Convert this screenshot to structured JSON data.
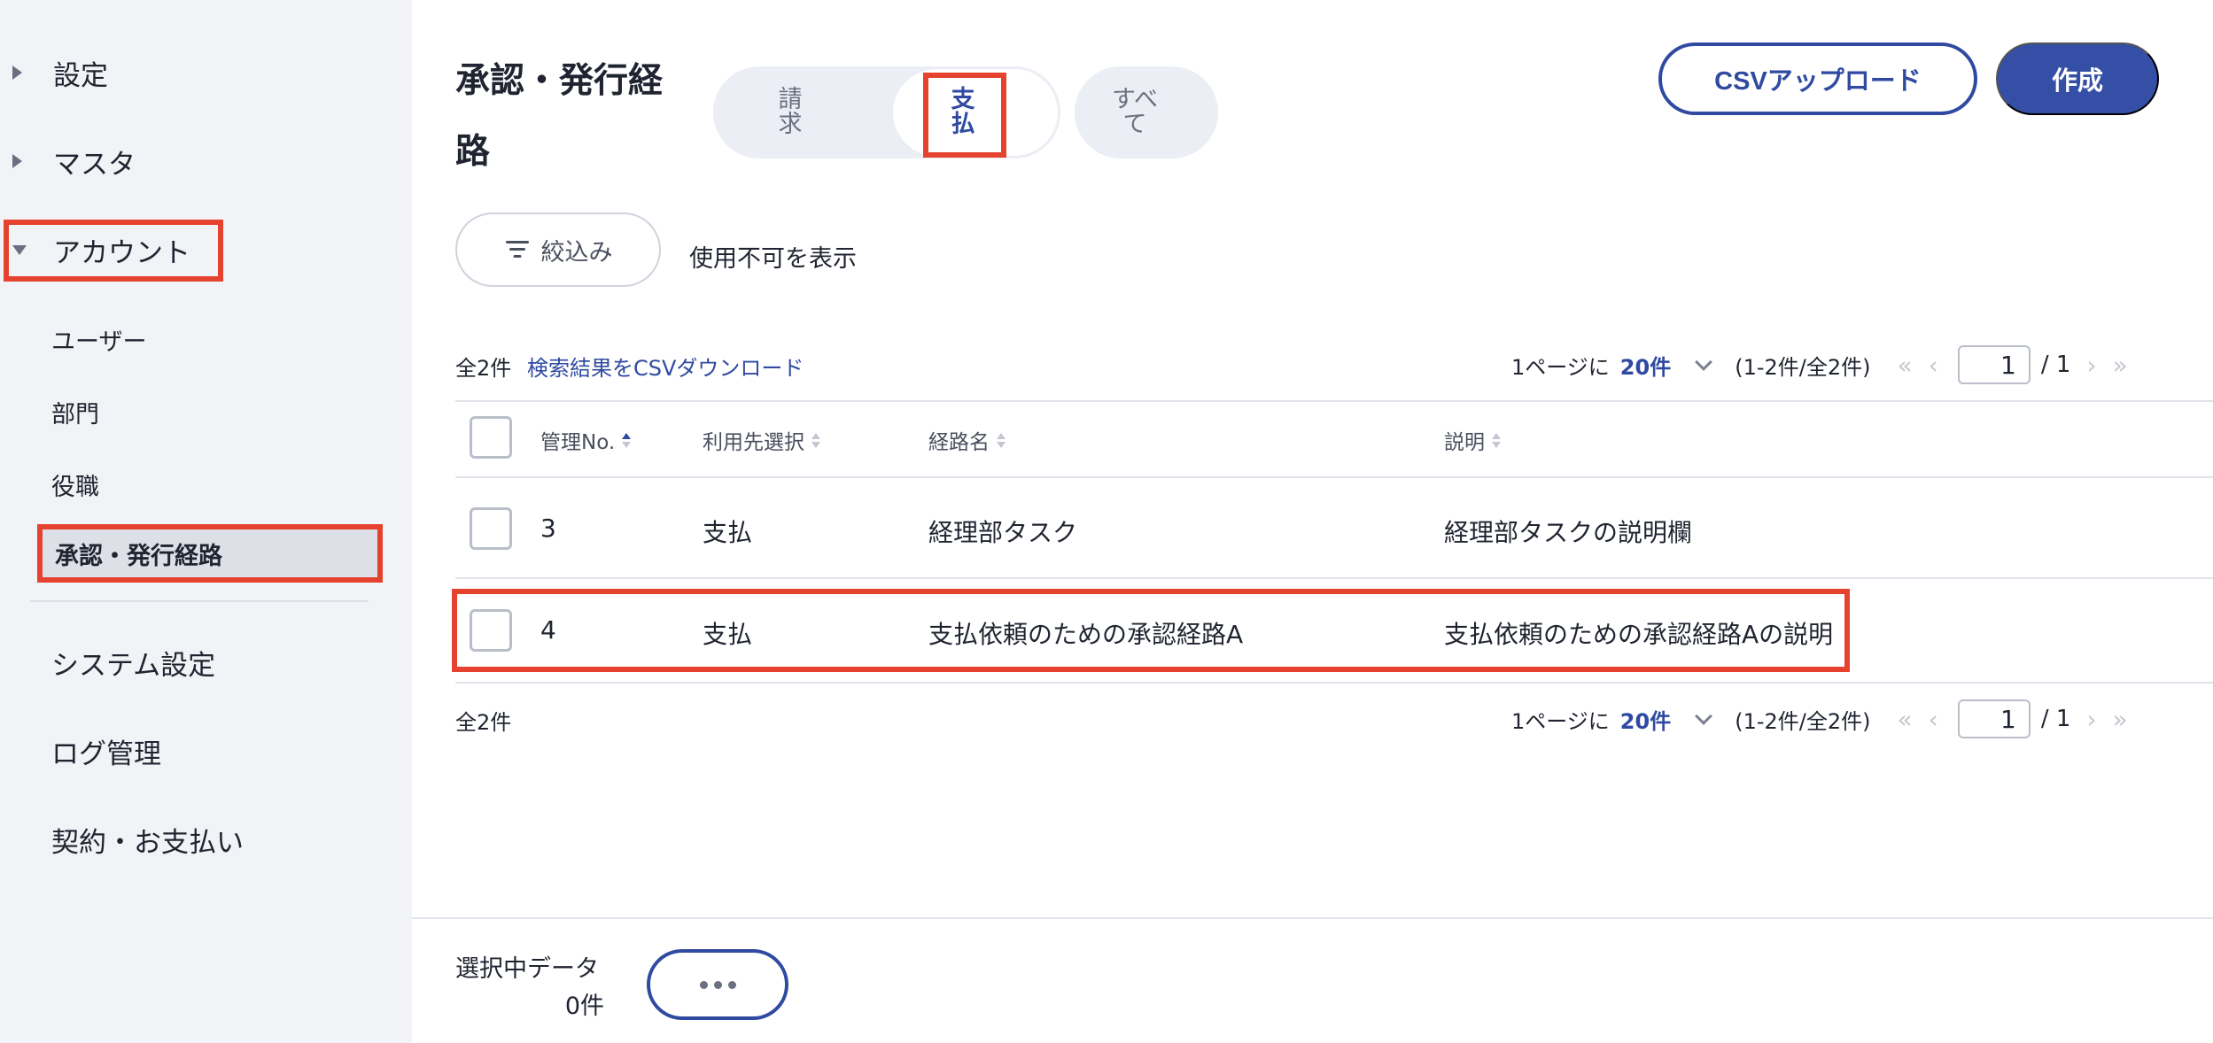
{
  "sidebar": {
    "groups": [
      {
        "label": "設定",
        "expanded": false
      },
      {
        "label": "マスタ",
        "expanded": false
      },
      {
        "label": "アカウント",
        "expanded": true
      }
    ],
    "account_items": [
      "ユーザー",
      "部門",
      "役職",
      "承認・発行経路"
    ],
    "active_item": "承認・発行経路",
    "other_items": [
      "システム設定",
      "ログ管理",
      "契約・お支払い"
    ]
  },
  "header": {
    "title": "承認・発行経路",
    "segments": [
      {
        "label": "請求",
        "active": false
      },
      {
        "label": "支払",
        "active": true
      },
      {
        "label": "すべて",
        "active": false
      }
    ],
    "csv_upload_label": "CSVアップロード",
    "create_label": "作成"
  },
  "filters": {
    "filter_label": "絞込み",
    "show_disabled_label": "使用不可を表示"
  },
  "results": {
    "total_label": "全2件",
    "csv_download_label": "検索結果をCSVダウンロード",
    "per_page_prefix": "1ページに",
    "per_page_value": "20件",
    "range_label": "(1-2件/全2件)",
    "current_page": "1",
    "total_pages_label": "/ 1",
    "nav_first": "«",
    "nav_prev": "‹",
    "nav_next": "›",
    "nav_last": "»"
  },
  "table": {
    "columns": [
      "管理No.",
      "利用先選択",
      "経路名",
      "説明"
    ],
    "rows": [
      {
        "no": "3",
        "target": "支払",
        "name": "経理部タスク",
        "description": "経理部タスクの説明欄"
      },
      {
        "no": "4",
        "target": "支払",
        "name": "支払依頼のための承認経路A",
        "description": "支払依頼のための承認経路Aの説明"
      }
    ]
  },
  "footer": {
    "selected_label": "選択中データ",
    "selected_count": "0件"
  },
  "colors": {
    "accent": "#2f4aa0",
    "highlight": "#e5432f",
    "sidebar_bg": "#f2f3f7"
  }
}
